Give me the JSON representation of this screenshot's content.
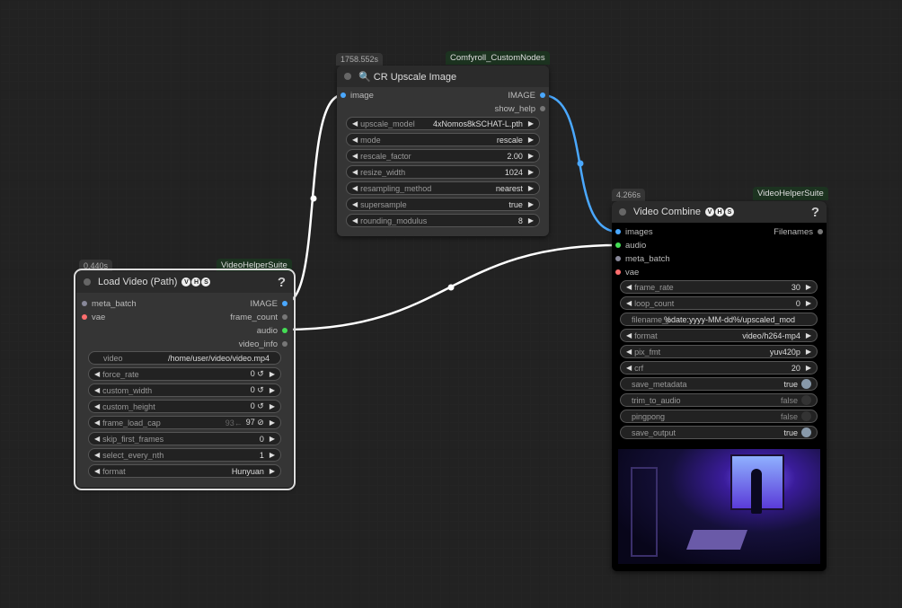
{
  "upscale": {
    "time": "1758.552s",
    "tag": "Comfyroll_CustomNodes",
    "title": "🔍 CR Upscale Image",
    "inputs": [
      "image"
    ],
    "outputs": [
      "IMAGE",
      "show_help"
    ],
    "widgets": [
      {
        "label": "upscale_model",
        "value": "4xNomos8kSCHAT-L.pth"
      },
      {
        "label": "mode",
        "value": "rescale"
      },
      {
        "label": "rescale_factor",
        "value": "2.00"
      },
      {
        "label": "resize_width",
        "value": "1024"
      },
      {
        "label": "resampling_method",
        "value": "nearest"
      },
      {
        "label": "supersample",
        "value": "true"
      },
      {
        "label": "rounding_modulus",
        "value": "8"
      }
    ]
  },
  "load": {
    "time": "0.440s",
    "tag": "VideoHelperSuite",
    "title": "Load Video (Path)",
    "help": "?",
    "inputs": [
      "meta_batch",
      "vae"
    ],
    "outputs": [
      "IMAGE",
      "frame_count",
      "audio",
      "video_info"
    ],
    "video": {
      "label": "video",
      "value": "/home/user/video/video.mp4"
    },
    "widgets": [
      {
        "label": "force_rate",
        "value": "0 ↺"
      },
      {
        "label": "custom_width",
        "value": "0 ↺"
      },
      {
        "label": "custom_height",
        "value": "0 ↺"
      },
      {
        "label": "frame_load_cap",
        "value": "97 ⊘",
        "hint": "93←"
      },
      {
        "label": "skip_first_frames",
        "value": "0"
      },
      {
        "label": "select_every_nth",
        "value": "1"
      },
      {
        "label": "format",
        "value": "Hunyuan"
      }
    ]
  },
  "combine": {
    "time": "4.266s",
    "tag": "VideoHelperSuite",
    "title": "Video Combine",
    "help": "?",
    "inputs": [
      "images",
      "audio",
      "meta_batch",
      "vae"
    ],
    "outputs": [
      "Filenames"
    ],
    "widgets": [
      {
        "label": "frame_rate",
        "value": "30"
      },
      {
        "label": "loop_count",
        "value": "0"
      }
    ],
    "prefix": {
      "label": "filename_prefix",
      "value": "%date:yyyy-MM-dd%/upscaled_mod"
    },
    "widgets2": [
      {
        "label": "format",
        "value": "video/h264-mp4"
      },
      {
        "label": "pix_fmt",
        "value": "yuv420p"
      },
      {
        "label": "crf",
        "value": "20"
      }
    ],
    "toggles": [
      {
        "label": "save_metadata",
        "value": "true",
        "on": true
      },
      {
        "label": "trim_to_audio",
        "value": "false",
        "on": false
      },
      {
        "label": "pingpong",
        "value": "false",
        "on": false
      },
      {
        "label": "save_output",
        "value": "true",
        "on": true
      }
    ]
  },
  "badges": [
    "V",
    "H",
    "S"
  ],
  "colors": {
    "image": "#4aa8ff",
    "audio": "#44dd55",
    "vae": "#ff6e6e",
    "other": "#888899"
  }
}
